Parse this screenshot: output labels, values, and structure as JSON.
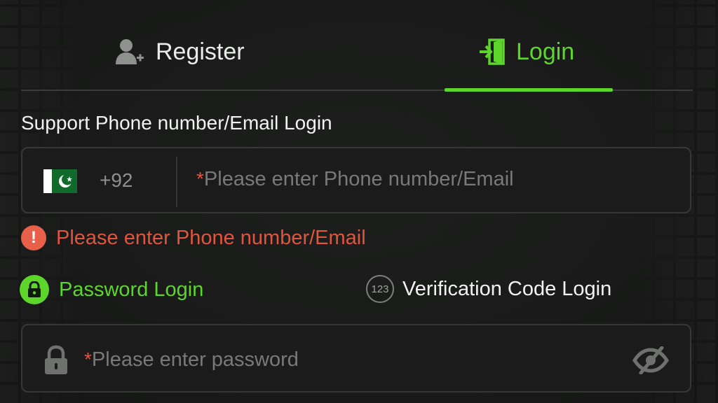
{
  "tabs": {
    "register_label": "Register",
    "login_label": "Login",
    "active": "login"
  },
  "form": {
    "support_label": "Support Phone number/Email Login",
    "phone": {
      "country_flag": "pakistan-flag-icon",
      "dial_code": "+92",
      "required_mark": "*",
      "placeholder": "Please enter Phone number/Email",
      "value": ""
    },
    "error": {
      "icon_glyph": "!",
      "message": "Please enter Phone number/Email"
    },
    "methods": {
      "password_label": "Password Login",
      "code_label": "Verification Code Login",
      "code_icon_text": "123",
      "active": "password"
    },
    "password": {
      "required_mark": "*",
      "placeholder": "Please enter password",
      "value": ""
    }
  },
  "colors": {
    "accent": "#5dd62c",
    "error": "#e0553d",
    "background": "#191a19",
    "border": "#363836"
  }
}
